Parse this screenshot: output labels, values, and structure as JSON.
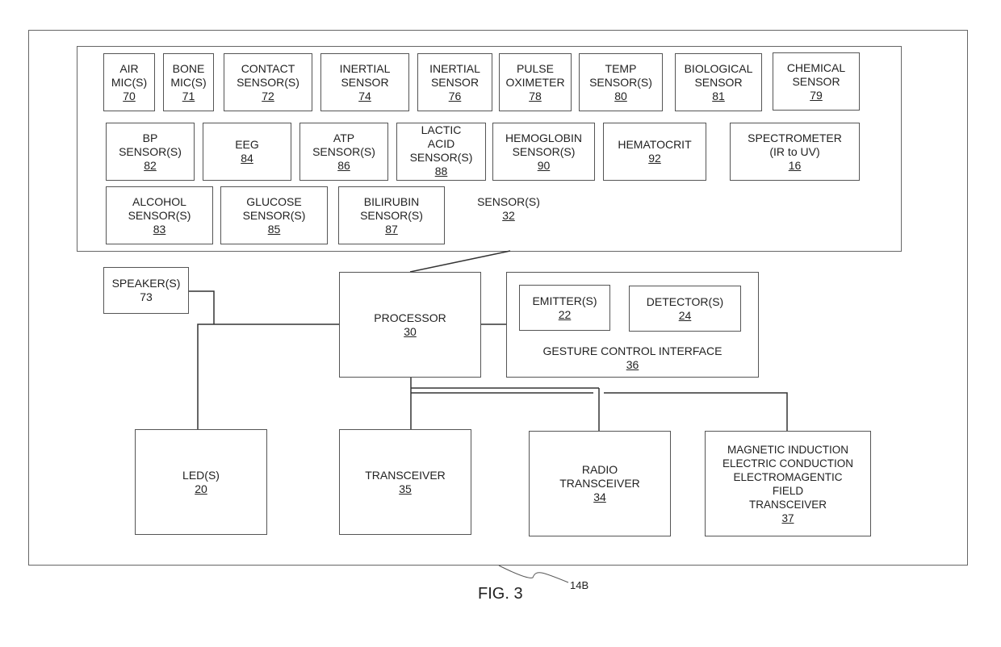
{
  "figure": {
    "label": "FIG. 3",
    "ref": "14B"
  },
  "sensor_group": {
    "name": "SENSOR(S)",
    "num": "32"
  },
  "sensors_row1": [
    {
      "lines": [
        "AIR",
        "MIC(S)"
      ],
      "num": "70"
    },
    {
      "lines": [
        "BONE",
        "MIC(S)"
      ],
      "num": "71"
    },
    {
      "lines": [
        "CONTACT",
        "SENSOR(S)"
      ],
      "num": "72"
    },
    {
      "lines": [
        "INERTIAL",
        "SENSOR"
      ],
      "num": "74"
    },
    {
      "lines": [
        "INERTIAL",
        "SENSOR"
      ],
      "num": "76"
    },
    {
      "lines": [
        "PULSE",
        "OXIMETER"
      ],
      "num": "78"
    },
    {
      "lines": [
        "TEMP",
        "SENSOR(S)"
      ],
      "num": "80"
    },
    {
      "lines": [
        "BIOLOGICAL",
        "SENSOR"
      ],
      "num": "81"
    },
    {
      "lines": [
        "CHEMICAL",
        "SENSOR"
      ],
      "num": "79"
    }
  ],
  "sensors_row2": [
    {
      "lines": [
        "BP",
        "SENSOR(S)"
      ],
      "num": "82"
    },
    {
      "lines": [
        "EEG"
      ],
      "num": "84"
    },
    {
      "lines": [
        "ATP",
        "SENSOR(S)"
      ],
      "num": "86"
    },
    {
      "lines": [
        "LACTIC",
        "ACID",
        "SENSOR(S)"
      ],
      "num": "88"
    },
    {
      "lines": [
        "HEMOGLOBIN",
        "SENSOR(S)"
      ],
      "num": "90"
    },
    {
      "lines": [
        "HEMATOCRIT"
      ],
      "num": "92"
    },
    {
      "lines": [
        "SPECTROMETER",
        "(IR to UV)"
      ],
      "num": "16"
    }
  ],
  "sensors_row3": [
    {
      "lines": [
        "ALCOHOL",
        "SENSOR(S)"
      ],
      "num": "83"
    },
    {
      "lines": [
        "GLUCOSE",
        "SENSOR(S)"
      ],
      "num": "85"
    },
    {
      "lines": [
        "BILIRUBIN",
        "SENSOR(S)"
      ],
      "num": "87"
    }
  ],
  "speaker": {
    "name": "SPEAKER(S)",
    "num": "73"
  },
  "processor": {
    "name": "PROCESSOR",
    "num": "30"
  },
  "gesture": {
    "name": "GESTURE CONTROL INTERFACE",
    "num": "36",
    "emitter": {
      "name": "EMITTER(S)",
      "num": "22"
    },
    "detector": {
      "name": "DETECTOR(S)",
      "num": "24"
    }
  },
  "led": {
    "name": "LED(S)",
    "num": "20"
  },
  "transceiver": {
    "name": "TRANSCEIVER",
    "num": "35"
  },
  "radio": {
    "lines": [
      "RADIO",
      "TRANSCEIVER"
    ],
    "num": "34"
  },
  "magnetic": {
    "lines": [
      "MAGNETIC INDUCTION",
      "ELECTRIC CONDUCTION",
      "ELECTROMAGENTIC",
      "FIELD",
      "TRANSCEIVER"
    ],
    "num": "37"
  }
}
